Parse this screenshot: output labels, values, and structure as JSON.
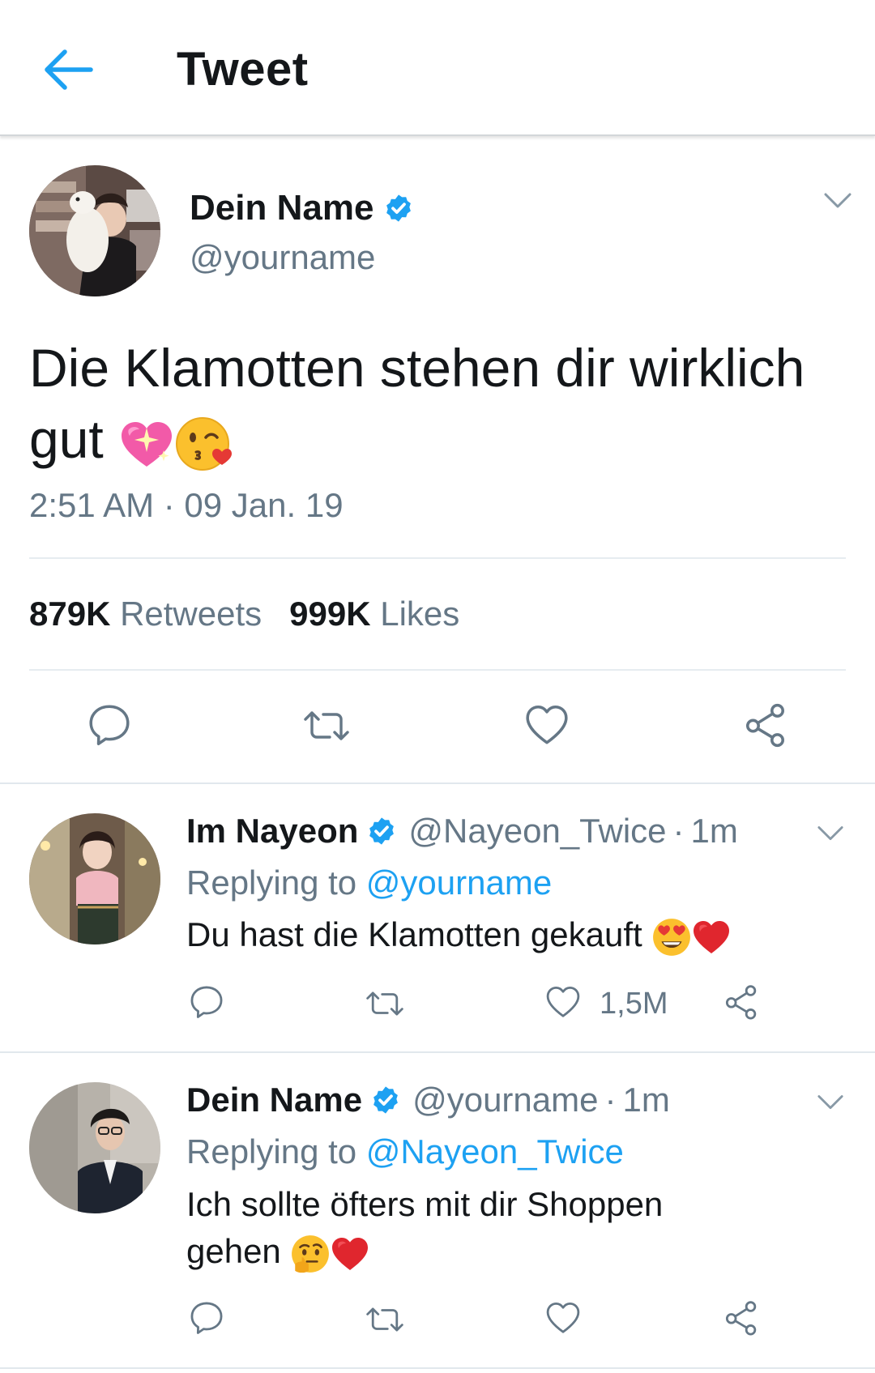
{
  "header": {
    "title": "Tweet"
  },
  "main_tweet": {
    "name": "Dein Name",
    "handle": "@yourname",
    "text": "Die Klamotten stehen dir wirklich gut",
    "timestamp": "2:51 AM · 09 Jan. 19",
    "retweets_count": "879K",
    "retweets_label": "Retweets",
    "likes_count": "999K",
    "likes_label": "Likes"
  },
  "replies": [
    {
      "name": "Im Nayeon",
      "handle": "@Nayeon_Twice",
      "separator": "·",
      "time": "1m",
      "replying_prefix": "Replying to",
      "replying_to": "@yourname",
      "text": "Du hast die Klamotten gekauft",
      "like_count": "1,5M"
    },
    {
      "name": "Dein Name",
      "handle": "@yourname",
      "separator": "·",
      "time": "1m",
      "replying_prefix": "Replying to",
      "replying_to": "@Nayeon_Twice",
      "text": "Ich sollte öfters mit dir Shoppen gehen"
    }
  ],
  "colors": {
    "accent": "#1da1f2",
    "text": "#14171a",
    "secondary": "#657786",
    "divider": "#e6ecf0"
  },
  "icons": [
    "back-arrow-icon",
    "verified-badge-icon",
    "chevron-down-icon",
    "reply-icon",
    "retweet-icon",
    "like-icon",
    "share-icon",
    "sparkling-heart-emoji",
    "kiss-face-emoji",
    "heart-eyes-emoji",
    "red-heart-emoji",
    "thinking-face-emoji"
  ]
}
